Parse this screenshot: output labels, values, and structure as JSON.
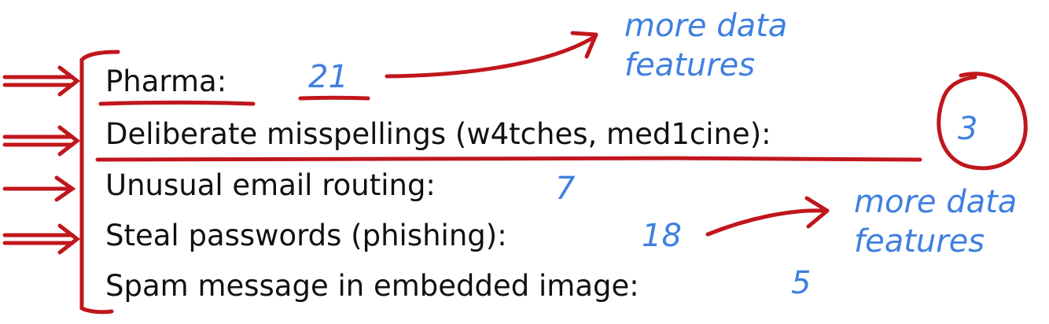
{
  "items": [
    {
      "label": "Pharma:",
      "count": "21"
    },
    {
      "label": "Deliberate misspellings (w4tches, med1cine):",
      "count": "3"
    },
    {
      "label": "Unusual email routing:",
      "count": "7"
    },
    {
      "label": "Steal passwords (phishing):",
      "count": "18"
    },
    {
      "label": "Spam message in embedded image:",
      "count": "5"
    }
  ],
  "notes": {
    "top": {
      "line1": "more data",
      "line2": "features"
    },
    "bottom": {
      "line1": "more data",
      "line2": "features"
    }
  },
  "colors": {
    "text": "#111111",
    "annotation_red": "#c0161c",
    "annotation_blue": "#3f7fe0"
  }
}
